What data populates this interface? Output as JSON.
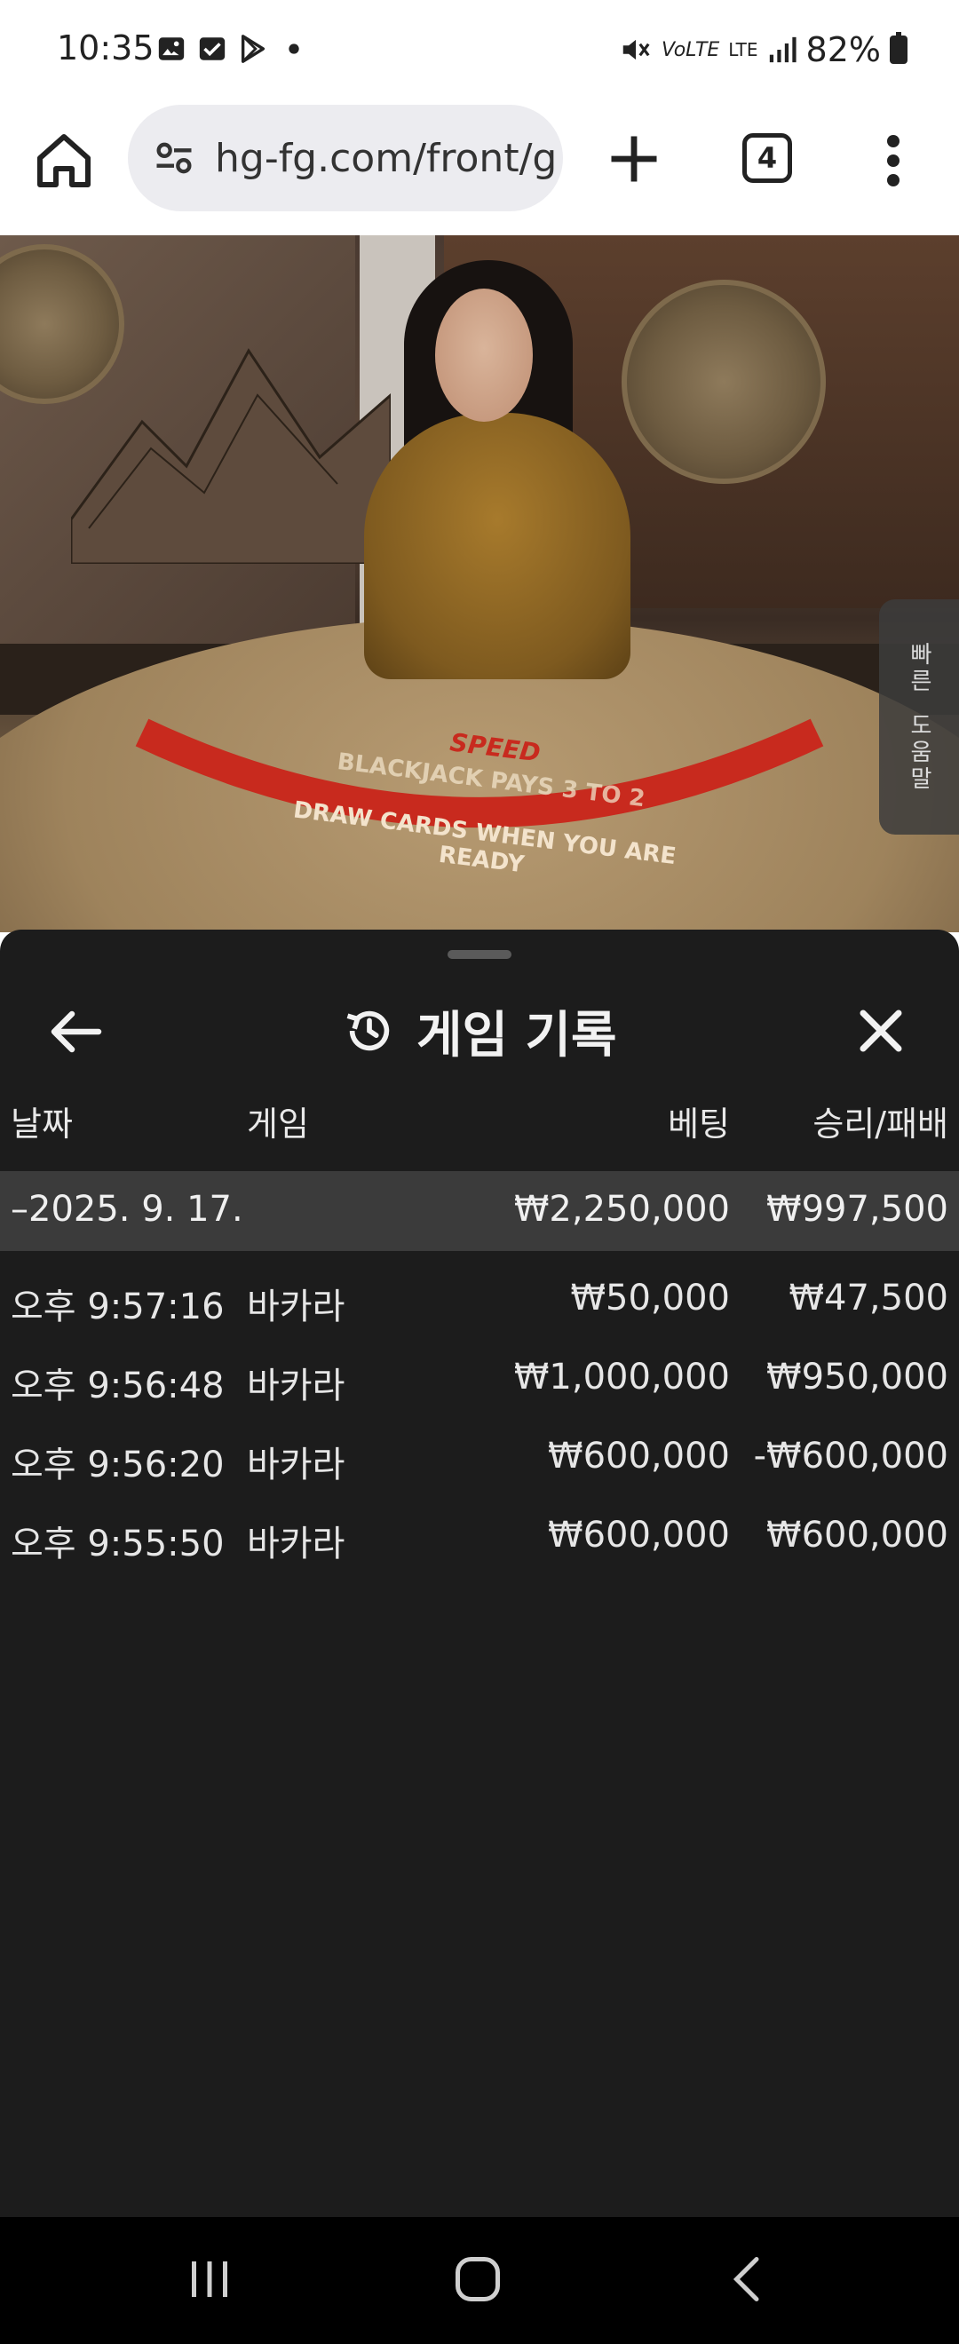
{
  "status_bar": {
    "time": "10:35",
    "battery": "82%",
    "icons": [
      "gallery-icon",
      "checkbox-icon",
      "play-store-icon",
      "dot-icon",
      "mute-icon",
      "volte-icon",
      "lte-icon",
      "signal-icon",
      "battery-icon"
    ]
  },
  "browser": {
    "url": "hg-fg.com/front/g",
    "tab_count": "4"
  },
  "video": {
    "table_line1": "BLACKJACK PAYS 3 TO 2",
    "table_line2": "DRAW CARDS WHEN YOU ARE READY",
    "logo_text": "SPEED",
    "side_tab": {
      "line1": "빠른",
      "line2": "도움말"
    }
  },
  "sheet": {
    "title": "게임 기록",
    "columns": {
      "date": "날짜",
      "game": "게임",
      "bet": "베팅",
      "win_loss": "승리/패배"
    },
    "day_summary": {
      "date": "–2025. 9. 17.",
      "bet": "₩2,250,000",
      "win_loss": "₩997,500"
    },
    "rows": [
      {
        "time": "오후 9:57:16",
        "game": "바카라",
        "bet": "₩50,000",
        "win_loss": "₩47,500"
      },
      {
        "time": "오후 9:56:48",
        "game": "바카라",
        "bet": "₩1,000,000",
        "win_loss": "₩950,000"
      },
      {
        "time": "오후 9:56:20",
        "game": "바카라",
        "bet": "₩600,000",
        "win_loss": "-₩600,000"
      },
      {
        "time": "오후 9:55:50",
        "game": "바카라",
        "bet": "₩600,000",
        "win_loss": "₩600,000"
      }
    ]
  },
  "colors": {
    "sheet_bg": "#1c1c1c",
    "summary_bg": "#3b3b3b",
    "text_light": "#e6e6e6"
  }
}
